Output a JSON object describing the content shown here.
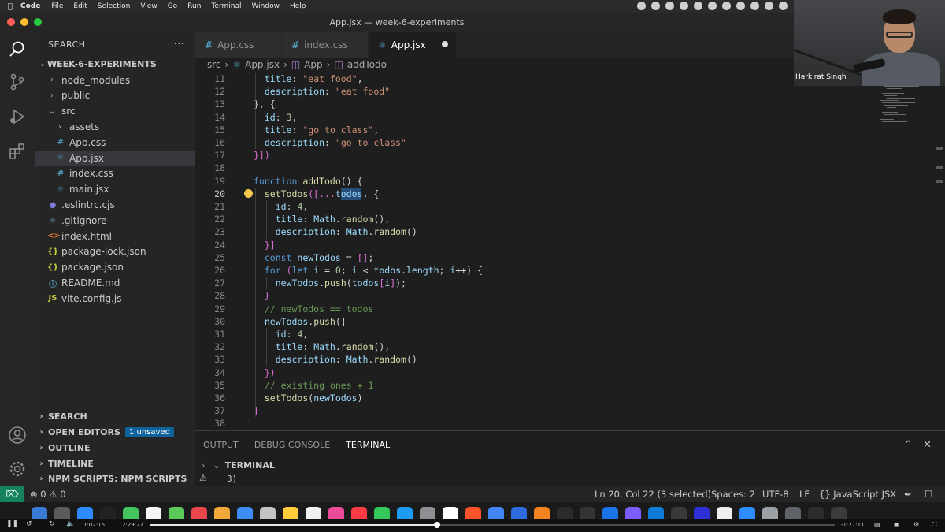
{
  "menubar": {
    "app": "Code",
    "items": [
      "File",
      "Edit",
      "Selection",
      "View",
      "Go",
      "Run",
      "Terminal",
      "Window",
      "Help"
    ]
  },
  "window": {
    "title": "App.jsx — week-6-experiments"
  },
  "sidebar": {
    "title": "SEARCH",
    "project": "WEEK-6-EXPERIMENTS",
    "tree": [
      {
        "label": "node_modules",
        "kind": "folder",
        "depth": 1,
        "icon": "chevron-right-icon"
      },
      {
        "label": "public",
        "kind": "folder",
        "depth": 1,
        "icon": "chevron-right-icon"
      },
      {
        "label": "src",
        "kind": "folder-open",
        "depth": 1,
        "icon": "chevron-down-icon"
      },
      {
        "label": "assets",
        "kind": "folder",
        "depth": 2,
        "icon": "chevron-right-icon"
      },
      {
        "label": "App.css",
        "kind": "css",
        "depth": 2,
        "glyph": "#",
        "color": "#519aba"
      },
      {
        "label": "App.jsx",
        "kind": "jsx",
        "depth": 2,
        "glyph": "⚛",
        "color": "#519aba",
        "selected": true
      },
      {
        "label": "index.css",
        "kind": "css",
        "depth": 2,
        "glyph": "#",
        "color": "#519aba"
      },
      {
        "label": "main.jsx",
        "kind": "jsx",
        "depth": 2,
        "glyph": "⚛",
        "color": "#519aba"
      },
      {
        "label": ".eslintrc.cjs",
        "kind": "file",
        "depth": 1,
        "glyph": "●",
        "color": "#7c7cd6"
      },
      {
        "label": ".gitignore",
        "kind": "file",
        "depth": 1,
        "glyph": "◆",
        "color": "#41535b"
      },
      {
        "label": "index.html",
        "kind": "html",
        "depth": 1,
        "glyph": "<>",
        "color": "#e37933"
      },
      {
        "label": "package-lock.json",
        "kind": "json",
        "depth": 1,
        "glyph": "{}",
        "color": "#cbcb41"
      },
      {
        "label": "package.json",
        "kind": "json",
        "depth": 1,
        "glyph": "{}",
        "color": "#cbcb41"
      },
      {
        "label": "README.md",
        "kind": "md",
        "depth": 1,
        "glyph": "ⓘ",
        "color": "#519aba"
      },
      {
        "label": "vite.config.js",
        "kind": "js",
        "depth": 1,
        "glyph": "JS",
        "color": "#cbcb41"
      }
    ],
    "sections": [
      {
        "label": "SEARCH"
      },
      {
        "label": "OPEN EDITORS",
        "badge": "1 unsaved"
      },
      {
        "label": "OUTLINE"
      },
      {
        "label": "TIMELINE"
      },
      {
        "label": "NPM SCRIPTS: NPM SCRIPTS"
      }
    ]
  },
  "tabs": [
    {
      "label": "App.css",
      "glyph": "#",
      "active": false
    },
    {
      "label": "index.css",
      "glyph": "#",
      "active": false
    },
    {
      "label": "App.jsx",
      "glyph": "⚛",
      "active": true,
      "unsaved": true
    }
  ],
  "breadcrumb": [
    "src",
    "App.jsx",
    "App",
    "addTodo"
  ],
  "editor": {
    "current_line": 20,
    "lines": [
      {
        "n": 11,
        "indent": 1,
        "tokens": [
          [
            "title",
            "p"
          ],
          [
            ": ",
            "t"
          ],
          [
            "\"eat food\"",
            "s"
          ],
          [
            ",",
            "t"
          ]
        ]
      },
      {
        "n": 12,
        "indent": 1,
        "tokens": [
          [
            "description",
            "p"
          ],
          [
            ": ",
            "t"
          ],
          [
            "\"eat food\"",
            "s"
          ]
        ]
      },
      {
        "n": 13,
        "indent": 0,
        "tokens": [
          [
            "}, {",
            "t"
          ]
        ]
      },
      {
        "n": 14,
        "indent": 1,
        "tokens": [
          [
            "id",
            "p"
          ],
          [
            ": ",
            "t"
          ],
          [
            "3",
            "n"
          ],
          [
            ",",
            "t"
          ]
        ]
      },
      {
        "n": 15,
        "indent": 1,
        "tokens": [
          [
            "title",
            "p"
          ],
          [
            ": ",
            "t"
          ],
          [
            "\"go to class\"",
            "s"
          ],
          [
            ",",
            "t"
          ]
        ]
      },
      {
        "n": 16,
        "indent": 1,
        "tokens": [
          [
            "description",
            "p"
          ],
          [
            ": ",
            "t"
          ],
          [
            "\"go to class\"",
            "s"
          ]
        ]
      },
      {
        "n": 17,
        "indent": 0,
        "tokens": [
          [
            "}])",
            "b"
          ]
        ]
      },
      {
        "n": 18,
        "indent": 0,
        "tokens": []
      },
      {
        "n": 19,
        "indent": 0,
        "tokens": [
          [
            "function ",
            "k"
          ],
          [
            "addTodo",
            "f"
          ],
          [
            "() {",
            "t"
          ]
        ]
      },
      {
        "n": 20,
        "indent": 1,
        "tokens": [
          [
            "setTodos",
            "f"
          ],
          [
            "([...",
            "b"
          ],
          [
            "todos",
            "v"
          ],
          [
            ", {",
            "t"
          ]
        ]
      },
      {
        "n": 21,
        "indent": 2,
        "tokens": [
          [
            "id",
            "p"
          ],
          [
            ": ",
            "t"
          ],
          [
            "4",
            "n"
          ],
          [
            ",",
            "t"
          ]
        ]
      },
      {
        "n": 22,
        "indent": 2,
        "tokens": [
          [
            "title",
            "p"
          ],
          [
            ": ",
            "t"
          ],
          [
            "Math",
            "v"
          ],
          [
            ".",
            "t"
          ],
          [
            "random",
            "f"
          ],
          [
            "(),",
            "t"
          ]
        ]
      },
      {
        "n": 23,
        "indent": 2,
        "tokens": [
          [
            "description",
            "p"
          ],
          [
            ": ",
            "t"
          ],
          [
            "Math",
            "v"
          ],
          [
            ".",
            "t"
          ],
          [
            "random",
            "f"
          ],
          [
            "()",
            "t"
          ]
        ]
      },
      {
        "n": 24,
        "indent": 1,
        "tokens": [
          [
            "}]",
            "b"
          ]
        ]
      },
      {
        "n": 25,
        "indent": 1,
        "tokens": [
          [
            "const ",
            "k"
          ],
          [
            "newTodos",
            "v"
          ],
          [
            " = ",
            "t"
          ],
          [
            "[]",
            "b"
          ],
          [
            ";",
            "t"
          ]
        ]
      },
      {
        "n": 26,
        "indent": 1,
        "tokens": [
          [
            "for ",
            "k"
          ],
          [
            "(",
            "b"
          ],
          [
            "let ",
            "k"
          ],
          [
            "i",
            "v"
          ],
          [
            " = ",
            "t"
          ],
          [
            "0",
            "n"
          ],
          [
            "; ",
            "t"
          ],
          [
            "i",
            "v"
          ],
          [
            " < ",
            "t"
          ],
          [
            "todos",
            "v"
          ],
          [
            ".",
            "t"
          ],
          [
            "length",
            "v"
          ],
          [
            "; ",
            "t"
          ],
          [
            "i",
            "v"
          ],
          [
            "++) {",
            "t"
          ]
        ]
      },
      {
        "n": 27,
        "indent": 2,
        "tokens": [
          [
            "newTodos",
            "v"
          ],
          [
            ".",
            "t"
          ],
          [
            "push",
            "f"
          ],
          [
            "(",
            "t"
          ],
          [
            "todos",
            "v"
          ],
          [
            "[",
            "b"
          ],
          [
            "i",
            "v"
          ],
          [
            "]",
            "b"
          ],
          [
            ");",
            "t"
          ]
        ]
      },
      {
        "n": 28,
        "indent": 1,
        "tokens": [
          [
            "}",
            "b"
          ]
        ]
      },
      {
        "n": 29,
        "indent": 1,
        "tokens": [
          [
            "// newTodos == todos",
            "c"
          ]
        ]
      },
      {
        "n": 30,
        "indent": 1,
        "tokens": [
          [
            "newTodos",
            "v"
          ],
          [
            ".",
            "t"
          ],
          [
            "push",
            "f"
          ],
          [
            "({",
            "t"
          ]
        ]
      },
      {
        "n": 31,
        "indent": 2,
        "tokens": [
          [
            "id",
            "p"
          ],
          [
            ": ",
            "t"
          ],
          [
            "4",
            "n"
          ],
          [
            ",",
            "t"
          ]
        ]
      },
      {
        "n": 32,
        "indent": 2,
        "tokens": [
          [
            "title",
            "p"
          ],
          [
            ": ",
            "t"
          ],
          [
            "Math",
            "v"
          ],
          [
            ".",
            "t"
          ],
          [
            "random",
            "f"
          ],
          [
            "(),",
            "t"
          ]
        ]
      },
      {
        "n": 33,
        "indent": 2,
        "tokens": [
          [
            "description",
            "p"
          ],
          [
            ": ",
            "t"
          ],
          [
            "Math",
            "v"
          ],
          [
            ".",
            "t"
          ],
          [
            "random",
            "f"
          ],
          [
            "()",
            "t"
          ]
        ]
      },
      {
        "n": 34,
        "indent": 1,
        "tokens": [
          [
            "})",
            "b"
          ]
        ]
      },
      {
        "n": 35,
        "indent": 1,
        "tokens": [
          [
            "// existing ones + 1",
            "c"
          ]
        ]
      },
      {
        "n": 36,
        "indent": 1,
        "tokens": [
          [
            "setTodos",
            "f"
          ],
          [
            "(",
            "t"
          ],
          [
            "newTodos",
            "v"
          ],
          [
            ")",
            "t"
          ]
        ]
      },
      {
        "n": 37,
        "indent": 0,
        "tokens": [
          [
            "}",
            "b"
          ]
        ]
      },
      {
        "n": 38,
        "indent": 0,
        "tokens": []
      }
    ],
    "colors": {
      "t": "#d4d4d4",
      "p": "#9cdcfe",
      "s": "#ce9178",
      "n": "#b5cea8",
      "k": "#569cd6",
      "f": "#dcdcaa",
      "v": "#9cdcfe",
      "c": "#6a9955",
      "b": "#da70d6"
    }
  },
  "panel": {
    "tabs": [
      "OUTPUT",
      "DEBUG CONSOLE",
      "TERMINAL"
    ],
    "active_tab": "TERMINAL",
    "terminal_label": "TERMINAL",
    "output": "3)"
  },
  "statusbar": {
    "problems": "⊗ 0 ⚠ 0",
    "position": "Ln 20, Col 22 (3 selected)",
    "spaces": "Spaces: 2",
    "encoding": "UTF-8",
    "eol": "LF",
    "language": "{} JavaScript JSX"
  },
  "video": {
    "elapsed": "1:02:16",
    "total": "2:29:27",
    "remaining": "-1:27:11",
    "progress": 0.42
  },
  "webcam": {
    "name": "Harkirat Singh"
  },
  "accent": "#0e639c",
  "remote_color": "#16825d"
}
